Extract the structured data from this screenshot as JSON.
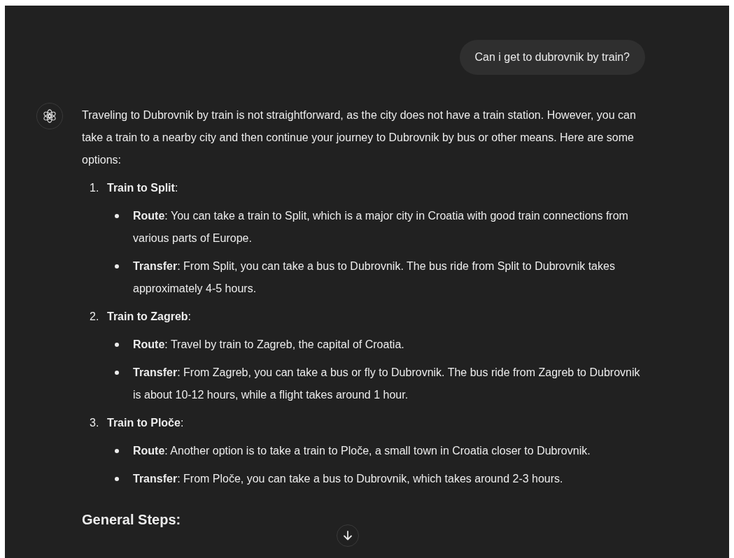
{
  "user_message": "Can i get to dubrovnik by train?",
  "assistant": {
    "intro": "Traveling to Dubrovnik by train is not straightforward, as the city does not have a train station. However, you can take a train to a nearby city and then continue your journey to Dubrovnik by bus or other means. Here are some options:",
    "options": [
      {
        "number": "1.",
        "title": "**Train to Split**:",
        "points": [
          "**Route**: You can take a train to Split, which is a major city in Croatia with good train connections from various parts of Europe.",
          "**Transfer**: From Split, you can take a bus to Dubrovnik. The bus ride from Split to Dubrovnik takes approximately 4-5 hours."
        ]
      },
      {
        "number": "2.",
        "title": "**Train to Zagreb**:",
        "points": [
          "**Route**: Travel by train to Zagreb, the capital of Croatia.",
          "**Transfer**: From Zagreb, you can take a bus or fly to Dubrovnik. The bus ride from Zagreb to Dubrovnik is about 10-12 hours, while a flight takes around 1 hour."
        ]
      },
      {
        "number": "3.",
        "title": "**Train to Ploče**:",
        "points": [
          "**Route**: Another option is to take a train to Ploče, a small town in Croatia closer to Dubrovnik.",
          "**Transfer**: From Ploče, you can take a bus to Dubrovnik, which takes around 2-3 hours."
        ]
      }
    ],
    "heading": "General Steps:"
  }
}
